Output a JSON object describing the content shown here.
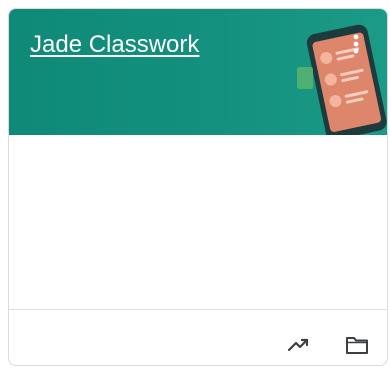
{
  "class_card": {
    "title": "Jade Classwork",
    "banner_color": "#128c7a",
    "icons": {
      "more": "more-vertical-icon",
      "gradebook": "trending-up-icon",
      "drive_folder": "folder-icon"
    }
  }
}
